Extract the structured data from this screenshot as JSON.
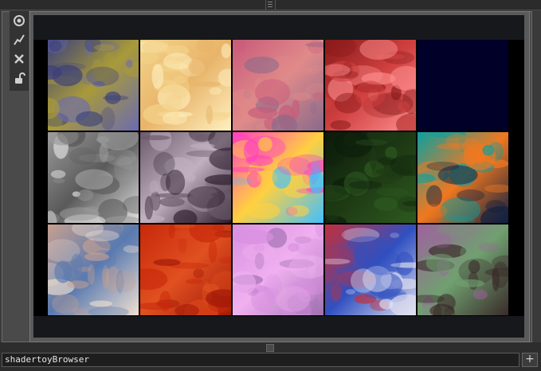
{
  "window": {
    "node_name": "shadertoyBrowser"
  },
  "toolbar": {
    "buttons": [
      {
        "name": "viewer-target-button",
        "icon": "target-icon"
      },
      {
        "name": "graph-button",
        "icon": "graph-icon"
      },
      {
        "name": "close-button",
        "icon": "close-icon"
      },
      {
        "name": "lock-button",
        "icon": "lock-icon"
      }
    ]
  },
  "browser": {
    "rows": 3,
    "columns": 5,
    "thumbnails": [
      {
        "id": "noise-blue-gold",
        "palette": [
          "#3a3f7a",
          "#a89a3a",
          "#6b6bb0"
        ]
      },
      {
        "id": "cream-waves",
        "palette": [
          "#f3d38a",
          "#e8b46a",
          "#fff0c0"
        ]
      },
      {
        "id": "pink-marble",
        "palette": [
          "#c85a7a",
          "#e08a8a",
          "#8a6a8a"
        ]
      },
      {
        "id": "red-cells",
        "palette": [
          "#8a1a1a",
          "#d04040",
          "#ff9090"
        ]
      },
      {
        "id": "dark-blue",
        "palette": [
          "#000029",
          "#000033",
          "#00002a"
        ]
      },
      {
        "id": "grey-fibers",
        "palette": [
          "#9a9a9a",
          "#5a5a5a",
          "#e0e0e0"
        ]
      },
      {
        "id": "metal-erosion",
        "palette": [
          "#6a5a6a",
          "#c0b0c0",
          "#2a1a2a"
        ]
      },
      {
        "id": "psychedelic-swirl",
        "palette": [
          "#ff40c0",
          "#ffd040",
          "#40c0ff"
        ]
      },
      {
        "id": "green-fog",
        "palette": [
          "#0a1a0a",
          "#1e3a14",
          "#2e5a20"
        ]
      },
      {
        "id": "turquoise-worms",
        "palette": [
          "#0aa0a0",
          "#f07820",
          "#102040"
        ]
      },
      {
        "id": "blue-blobs",
        "palette": [
          "#c8a090",
          "#5a7ab0",
          "#f0e0d0"
        ]
      },
      {
        "id": "red-lava",
        "palette": [
          "#c8280a",
          "#e05020",
          "#a01808"
        ]
      },
      {
        "id": "violet-haze",
        "palette": [
          "#d890e0",
          "#f0b0f0",
          "#a070b0"
        ]
      },
      {
        "id": "circuit-maze",
        "palette": [
          "#c03040",
          "#3050c0",
          "#e0e0f0"
        ]
      },
      {
        "id": "purple-cells",
        "palette": [
          "#a060a0",
          "#70a070",
          "#3a2a2a"
        ]
      }
    ]
  }
}
